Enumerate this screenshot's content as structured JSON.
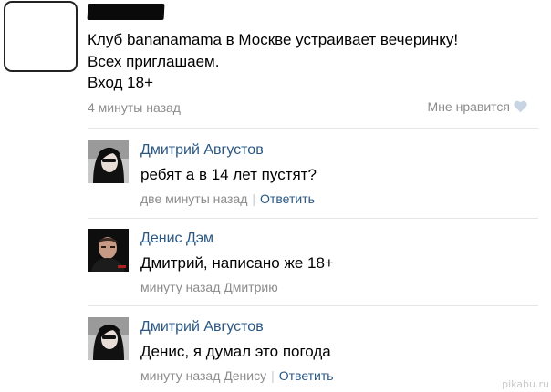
{
  "post": {
    "text_lines": [
      "Клуб bananamama в Москве устраивает вечеринку!",
      "Всех приглашаем.",
      "Вход 18+"
    ],
    "time": "4 минуты назад",
    "like_label": "Мне нравится",
    "like_icon": "heart-icon"
  },
  "comments": [
    {
      "author": "Дмитрий Августов",
      "text": "ребят а в 14 лет пустят?",
      "time": "две минуты назад",
      "reply_label": "Ответить"
    },
    {
      "author": "Денис Дэм",
      "text": "Дмитрий, написано же 18+",
      "time": "минуту назад Дмитрию"
    },
    {
      "author": "Дмитрий Августов",
      "text": "Денис, я думал это погода",
      "time": "минуту назад Денису",
      "reply_label": "Ответить"
    }
  ],
  "watermark": "pikabu.ru",
  "colors": {
    "link": "#2a5885",
    "meta": "#8c8c8c",
    "divider": "#e4e6ea"
  }
}
